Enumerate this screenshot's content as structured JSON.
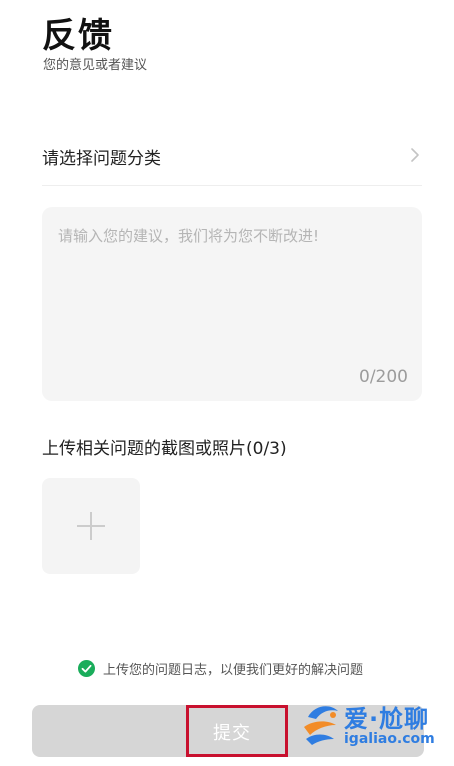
{
  "header": {
    "title": "反馈",
    "subtitle": "您的意见或者建议"
  },
  "category": {
    "label": "请选择问题分类",
    "icon": "chevron-right-icon"
  },
  "suggestion": {
    "placeholder": "请输入您的建议，我们将为您不断改进!",
    "value": "",
    "counter": "0/200"
  },
  "upload": {
    "label": "上传相关问题的截图或照片(0/3)",
    "icon": "plus-icon"
  },
  "log_consent": {
    "text": "上传您的问题日志，以便我们更好的解决问题",
    "checked": true,
    "icon": "check-circle-icon",
    "color": "#1aad5b"
  },
  "submit": {
    "label": "提交",
    "background": "#d6d6d6",
    "highlight_color": "#c8102e"
  },
  "watermark": {
    "name": "爱·尬聊",
    "url": "igaliao.com",
    "color": "#2f7de1"
  }
}
